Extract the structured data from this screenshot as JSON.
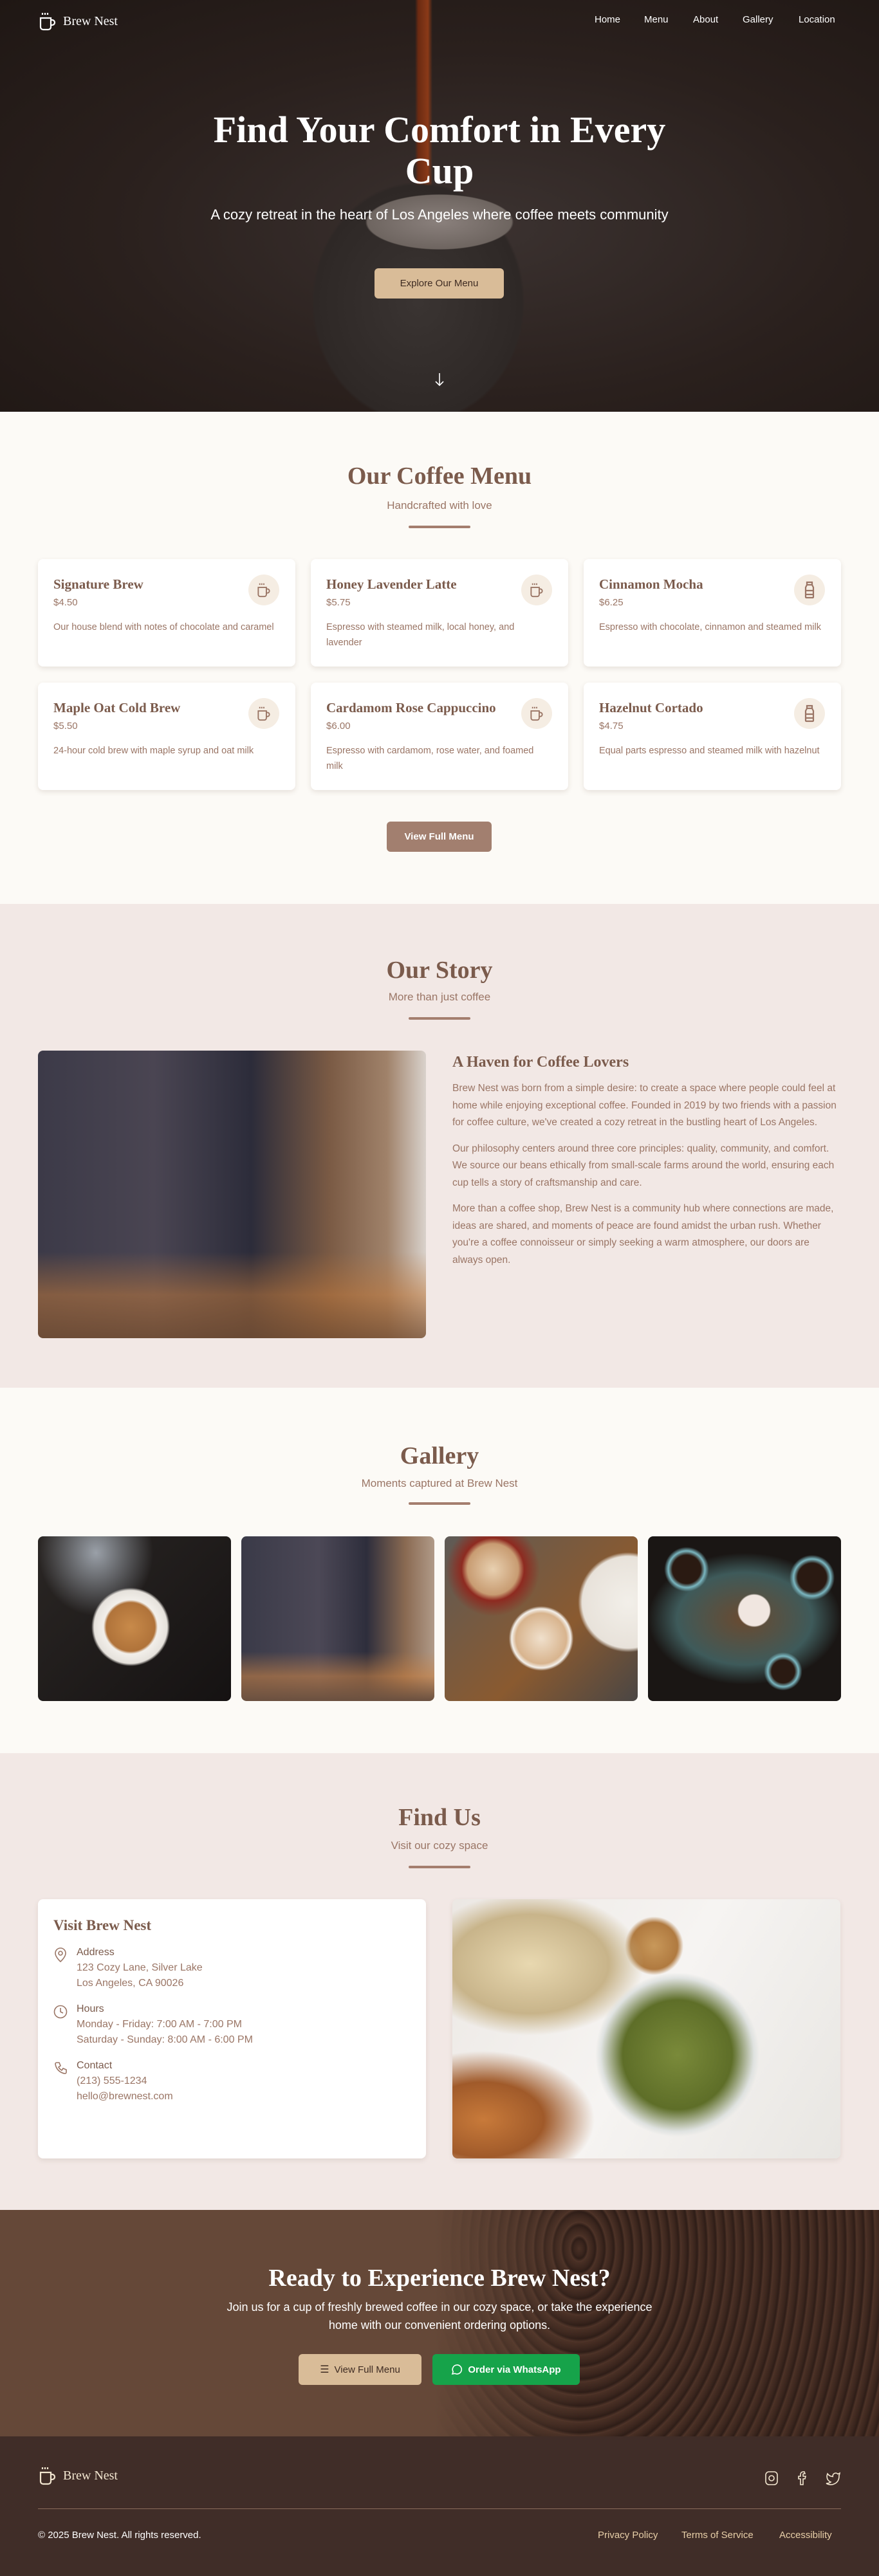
{
  "brand": {
    "name": "Brew Nest",
    "logo_icon": "coffee-cup-icon"
  },
  "nav": {
    "items": [
      {
        "label": "Home"
      },
      {
        "label": "Menu"
      },
      {
        "label": "About"
      },
      {
        "label": "Gallery"
      },
      {
        "label": "Location"
      }
    ]
  },
  "hero": {
    "title": "Find Your Comfort in Every Cup",
    "subtitle": "A cozy retreat in the heart of Los Angeles where coffee meets community",
    "cta_label": "Explore Our Menu",
    "scroll_icon": "arrow-down-icon"
  },
  "menu": {
    "title": "Our Coffee Menu",
    "subtitle": "Handcrafted with love",
    "items": [
      {
        "name": "Signature Brew",
        "price": "$4.50",
        "description": "Our house blend with notes of chocolate and caramel",
        "icon": "coffee-cup-icon"
      },
      {
        "name": "Honey Lavender Latte",
        "price": "$5.75",
        "description": "Espresso with steamed milk, local honey, and lavender",
        "icon": "coffee-cup-icon"
      },
      {
        "name": "Cinnamon Mocha",
        "price": "$6.25",
        "description": "Espresso with chocolate, cinnamon and steamed milk",
        "icon": "milk-bottle-icon"
      },
      {
        "name": "Maple Oat Cold Brew",
        "price": "$5.50",
        "description": "24-hour cold brew with maple syrup and oat milk",
        "icon": "coffee-cup-icon"
      },
      {
        "name": "Cardamom Rose Cappuccino",
        "price": "$6.00",
        "description": "Espresso with cardamom, rose water, and foamed milk",
        "icon": "coffee-cup-icon"
      },
      {
        "name": "Hazelnut Cortado",
        "price": "$4.75",
        "description": "Equal parts espresso and steamed milk with hazelnut",
        "icon": "milk-bottle-icon"
      }
    ],
    "button_label": "View Full Menu"
  },
  "story": {
    "title": "Our Story",
    "subtitle": "More than just coffee",
    "heading": "A Haven for Coffee Lovers",
    "paragraphs": [
      "Brew Nest was born from a simple desire: to create a space where people could feel at home while enjoying exceptional coffee. Founded in 2019 by two friends with a passion for coffee culture, we've created a cozy retreat in the bustling heart of Los Angeles.",
      "Our philosophy centers around three core principles: quality, community, and comfort. We source our beans ethically from small-scale farms around the world, ensuring each cup tells a story of craftsmanship and care.",
      "More than a coffee shop, Brew Nest is a community hub where connections are made, ideas are shared, and moments of peace are found amidst the urban rush. Whether you're a coffee connoisseur or simply seeking a warm atmosphere, our doors are always open."
    ]
  },
  "gallery": {
    "title": "Gallery",
    "subtitle": "Moments captured at Brew Nest"
  },
  "find": {
    "title": "Find Us",
    "subtitle": "Visit our cozy space",
    "card_title": "Visit Brew Nest",
    "address": {
      "label": "Address",
      "lines": [
        "123 Cozy Lane, Silver Lake",
        "Los Angeles, CA 90026"
      ]
    },
    "hours": {
      "label": "Hours",
      "lines": [
        "Monday - Friday: 7:00 AM - 7:00 PM",
        "Saturday - Sunday: 8:00 AM - 6:00 PM"
      ]
    },
    "contact": {
      "label": "Contact",
      "lines": [
        "(213) 555-1234",
        "hello@brewnest.com"
      ]
    }
  },
  "cta": {
    "title": "Ready to Experience Brew Nest?",
    "text": "Join us for a cup of freshly brewed coffee in our cozy space, or take the experience home with our convenient ordering options.",
    "menu_button": "View Full Menu",
    "whatsapp_button": "Order via WhatsApp"
  },
  "footer": {
    "copyright": "© 2025 Brew Nest. All rights reserved.",
    "links": [
      {
        "label": "Privacy Policy"
      },
      {
        "label": "Terms of Service"
      },
      {
        "label": "Accessibility"
      }
    ],
    "social": [
      "instagram-icon",
      "facebook-icon",
      "twitter-icon"
    ]
  },
  "colors": {
    "accent": "#a47e6e",
    "heading": "#7b5b4c",
    "tan": "#d9bc98",
    "whatsapp": "#16a34a",
    "footer": "#402d28",
    "hero_bg": "#2a201d"
  }
}
